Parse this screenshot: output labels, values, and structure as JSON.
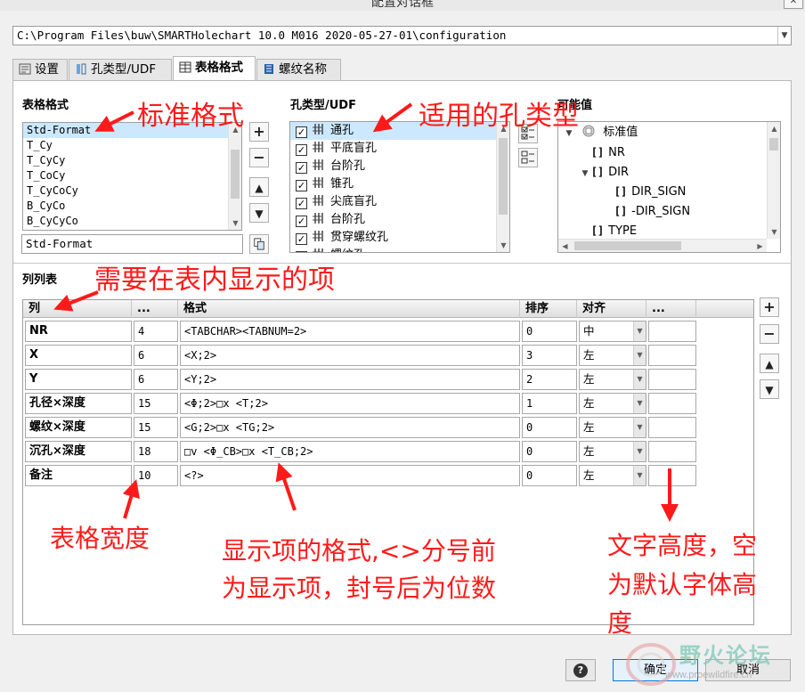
{
  "window": {
    "title": "配置对话框"
  },
  "config_path": {
    "value": "C:\\Program Files\\buw\\SMARTHolechart 10.0 M016 2020-05-27-01\\configuration"
  },
  "tabs": [
    {
      "label": "设置",
      "icon": "settings-icon"
    },
    {
      "label": "孔类型/UDF",
      "icon": "hole-type-icon"
    },
    {
      "label": "表格格式",
      "icon": "table-icon"
    },
    {
      "label": "螺纹名称",
      "icon": "thread-icon"
    }
  ],
  "table_format": {
    "section_label": "表格格式",
    "items": [
      "Std-Format",
      "T_Cy",
      "T_CyCy",
      "T_CoCy",
      "T_CyCoCy",
      "B_CyCo",
      "B_CyCyCo"
    ],
    "selected": "Std-Format",
    "name_value": "Std-Format"
  },
  "hole_types": {
    "section_label": "孔类型/UDF",
    "items": [
      "通孔",
      "平底盲孔",
      "台阶孔",
      "锥孔",
      "尖底盲孔",
      "台阶孔",
      "贯穿螺纹孔",
      "螺纹孔"
    ]
  },
  "possible_values": {
    "section_label": "可能值",
    "root": "标准值",
    "items": [
      "NR",
      "DIR",
      "DIR_SIGN",
      "-DIR_SIGN",
      "TYPE"
    ]
  },
  "columns": {
    "section_label": "列列表",
    "headers": [
      "列",
      "...",
      "格式",
      "排序",
      "对齐",
      "..."
    ],
    "rows": [
      {
        "name": "NR",
        "width": "4",
        "format": "<TABCHAR><TABNUM=2>",
        "sort": "0",
        "align": "中",
        "height": ""
      },
      {
        "name": "X",
        "width": "6",
        "format": "<X;2>",
        "sort": "3",
        "align": "左",
        "height": ""
      },
      {
        "name": "Y",
        "width": "6",
        "format": "<Y;2>",
        "sort": "2",
        "align": "左",
        "height": ""
      },
      {
        "name": "孔径×深度",
        "width": "15",
        "format": "<Φ;2>□x <T;2>",
        "sort": "1",
        "align": "左",
        "height": ""
      },
      {
        "name": "螺纹×深度",
        "width": "15",
        "format": "<G;2>□x <TG;2>",
        "sort": "0",
        "align": "左",
        "height": ""
      },
      {
        "name": "沉孔×深度",
        "width": "18",
        "format": "□v <Φ_CB>□x <T_CB;2>",
        "sort": "0",
        "align": "左",
        "height": ""
      },
      {
        "name": "备注",
        "width": "10",
        "format": "<?>",
        "sort": "0",
        "align": "左",
        "height": ""
      }
    ]
  },
  "annotations": {
    "std_format": "标准格式",
    "applicable_hole_types": "适用的孔类型",
    "items_to_show": "需要在表内显示的项",
    "table_width": "表格宽度",
    "format_line1": "显示项的格式,<>分号前",
    "format_line2": "为显示项，封号后为位数",
    "text_height_line1": "文字高度，空",
    "text_height_line2": "为默认字体高",
    "text_height_line3": "度"
  },
  "buttons": {
    "ok": "确定",
    "cancel": "取消",
    "help": "?"
  },
  "watermark": {
    "text": "野火论坛",
    "url": "www.proewildfire.cn"
  },
  "colors": {
    "annotation": "#ff1a1a",
    "selection": "#cce8ff"
  }
}
